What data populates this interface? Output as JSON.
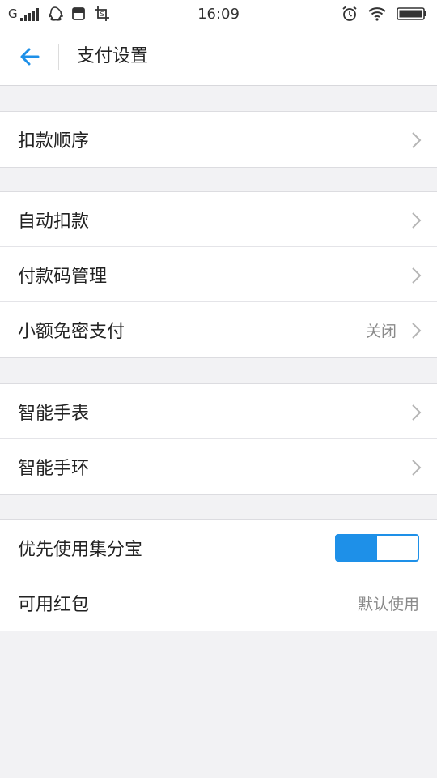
{
  "status_bar": {
    "carrier": "G",
    "time": "16:09",
    "icons": [
      "signal-icon",
      "qq-icon",
      "message-icon",
      "screenshot-icon",
      "alarm-icon",
      "wifi-icon",
      "battery-icon"
    ]
  },
  "header": {
    "title": "支付设置",
    "back_icon": "back-arrow-icon",
    "accent_color": "#1e90e8"
  },
  "groups": [
    {
      "items": [
        {
          "label": "扣款顺序",
          "chevron": true
        }
      ]
    },
    {
      "items": [
        {
          "label": "自动扣款",
          "chevron": true
        },
        {
          "label": "付款码管理",
          "chevron": true
        },
        {
          "label": "小额免密支付",
          "value": "关闭",
          "chevron": true
        }
      ]
    },
    {
      "items": [
        {
          "label": "智能手表",
          "chevron": true
        },
        {
          "label": "智能手环",
          "chevron": true
        }
      ]
    },
    {
      "items": [
        {
          "label": "优先使用集分宝",
          "toggle": true,
          "toggle_on": true
        },
        {
          "label": "可用红包",
          "value": "默认使用",
          "chevron": false
        }
      ]
    }
  ]
}
